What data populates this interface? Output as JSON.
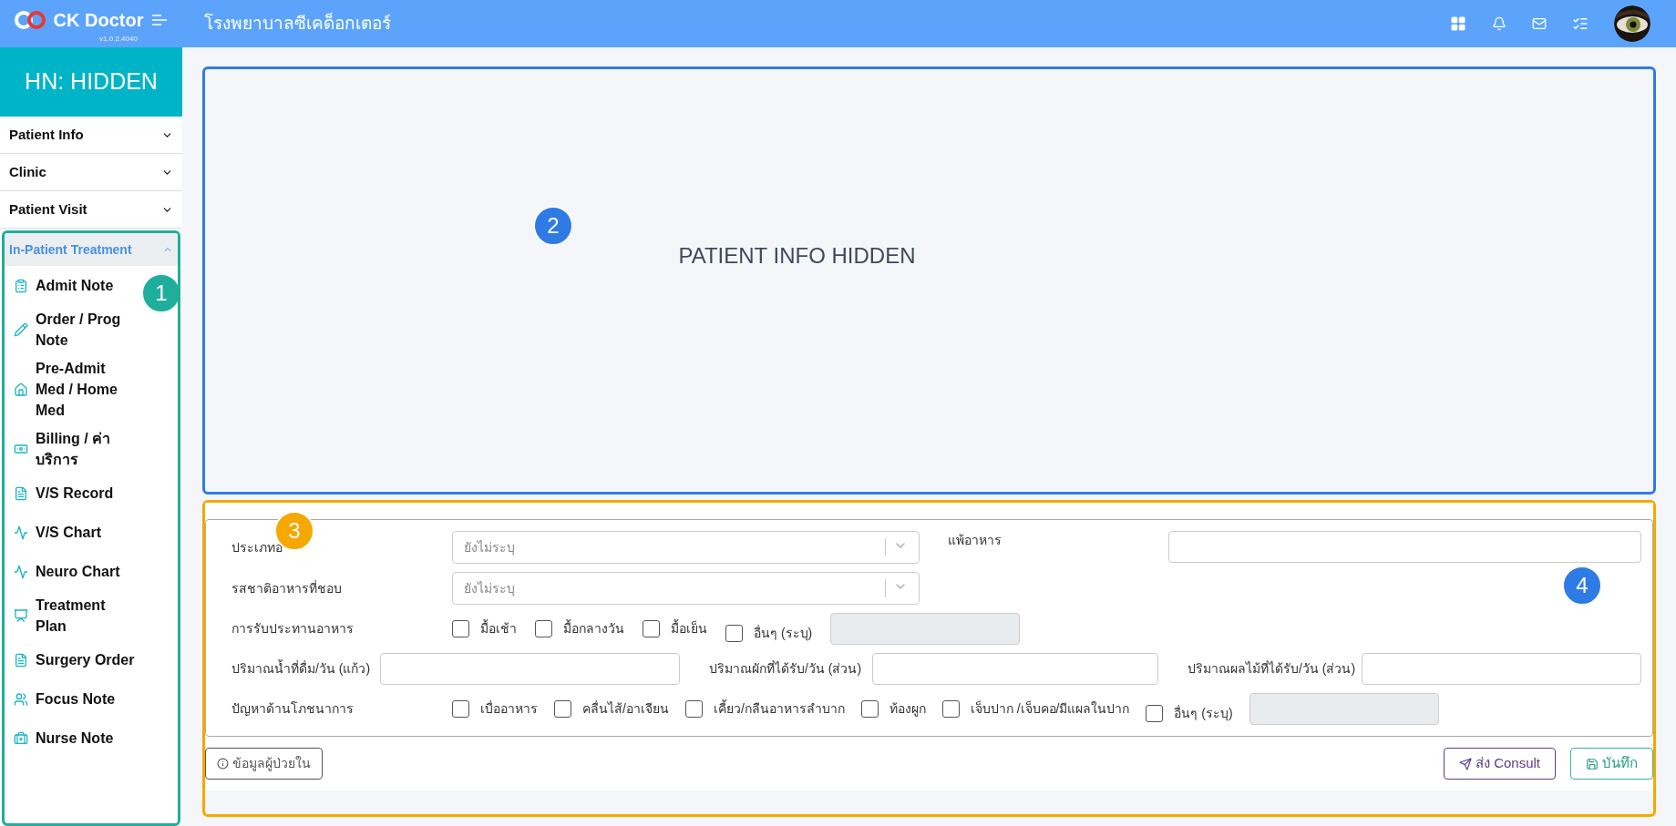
{
  "header": {
    "app_name": "CK Doctor",
    "version": "v1.0.2.4040",
    "hospital": "โรงพยาบาลซีเคด็อกเตอร์"
  },
  "sidebar": {
    "hn": "HN: HIDDEN",
    "sections": [
      {
        "label": "Patient Info",
        "expanded": false
      },
      {
        "label": "Clinic",
        "expanded": false
      },
      {
        "label": "Patient Visit",
        "expanded": false
      },
      {
        "label": "In-Patient Treatment",
        "expanded": true,
        "items": [
          {
            "label": "Admit Note"
          },
          {
            "label": "Order / Prog Note"
          },
          {
            "label": "Pre-Admit Med / Home Med"
          },
          {
            "label": "Billing / ค่าบริการ"
          },
          {
            "label": "V/S Record"
          },
          {
            "label": "V/S Chart"
          },
          {
            "label": "Neuro Chart"
          },
          {
            "label": "Treatment Plan"
          },
          {
            "label": "Surgery Order"
          },
          {
            "label": "Focus Note"
          },
          {
            "label": "Nurse Note"
          }
        ]
      }
    ]
  },
  "patient_panel": {
    "text": "PATIENT INFO HIDDEN"
  },
  "form": {
    "food_type": {
      "label": "ประเภทอ",
      "placeholder": "ยังไม่ระบุ"
    },
    "allergy": {
      "label": "แพ้อาหาร"
    },
    "taste": {
      "label": "รสชาติอาหารที่ชอบ",
      "placeholder": "ยังไม่ระบุ"
    },
    "meals": {
      "label": "การรับประทานอาหาร",
      "options": [
        {
          "label": "มื้อเช้า",
          "checked": false
        },
        {
          "label": "มื้อกลางวัน",
          "checked": false
        },
        {
          "label": "มื้อเย็น",
          "checked": false
        }
      ],
      "other": {
        "label": "อื่นๆ (ระบุ)",
        "checked": false
      }
    },
    "quantities": [
      {
        "label": "ปริมาณน้ำที่ดื่ม/วัน (แก้ว)"
      },
      {
        "label": "ปริมาณผักที่ได้รับ/วัน (ส่วน)"
      },
      {
        "label": "ปริมาณผลไม้ที่ได้รับ/วัน (ส่วน)"
      }
    ],
    "problems": {
      "label": "ปัญหาด้านโภชนาการ",
      "options": [
        {
          "label": "เบื่ออาหาร",
          "checked": false
        },
        {
          "label": "คลื่นไส้/อาเจียน",
          "checked": false
        },
        {
          "label": "เคี้ยว/กลืนอาหารลำบาก",
          "checked": false
        },
        {
          "label": "ท้องผูก",
          "checked": false
        },
        {
          "label": "เจ็บปาก /เจ็บคอ/มีแผลในปาก",
          "checked": false
        }
      ],
      "other": {
        "label": "อื่นๆ (ระบุ)",
        "checked": false
      }
    }
  },
  "buttons": {
    "info": "ข้อมูลผู้ป่วยใน",
    "consult": "ส่ง Consult",
    "save": "บันทึก"
  },
  "annotations": [
    {
      "number": "1",
      "color": "#1fae9b"
    },
    {
      "number": "2",
      "color": "#2f7be5"
    },
    {
      "number": "3",
      "color": "#f5a800"
    },
    {
      "number": "4",
      "color": "#2f7be5"
    }
  ]
}
